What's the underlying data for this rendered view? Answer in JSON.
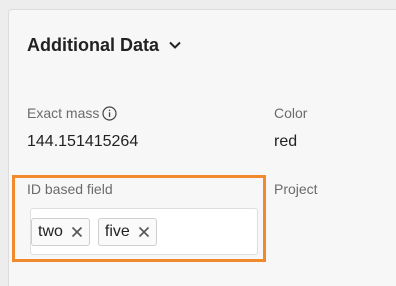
{
  "section": {
    "title": "Additional Data"
  },
  "fields": {
    "exact_mass": {
      "label": "Exact mass",
      "value": "144.151415264"
    },
    "color": {
      "label": "Color",
      "value": "red"
    },
    "id_based": {
      "label": "ID based field",
      "chips": [
        "two",
        "five"
      ]
    },
    "project": {
      "label": "Project"
    }
  },
  "colors": {
    "highlight": "#f08a2c"
  },
  "icons": {
    "section_toggle": "chevron-down-icon",
    "exact_mass_info": "info-icon",
    "chip_remove": "close-icon"
  }
}
